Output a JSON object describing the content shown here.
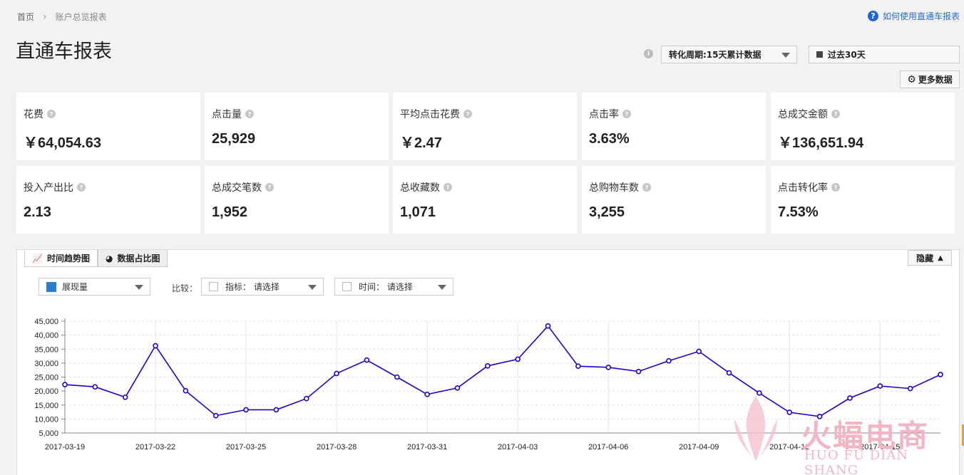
{
  "breadcrumb": {
    "home": "首页",
    "current": "账户总览报表"
  },
  "help_link": "如何使用直通车报表",
  "page_title": "直通车报表",
  "period_select": "转化周期:15天累计数据",
  "range_select": "过去30天",
  "more_data_button": "更多数据",
  "metrics": [
    {
      "label": "花费",
      "value": "￥64,054.63"
    },
    {
      "label": "点击量",
      "value": "25,929"
    },
    {
      "label": "平均点击花费",
      "value": "￥2.47"
    },
    {
      "label": "点击率",
      "value": "3.63%"
    },
    {
      "label": "总成交金额",
      "value": "￥136,651.94"
    },
    {
      "label": "投入产出比",
      "value": "2.13"
    },
    {
      "label": "总成交笔数",
      "value": "1,952"
    },
    {
      "label": "总收藏数",
      "value": "1,071"
    },
    {
      "label": "总购物车数",
      "value": "3,255"
    },
    {
      "label": "点击转化率",
      "value": "7.53%"
    }
  ],
  "tabs": {
    "trend": "时间趋势图",
    "share": "数据占比图"
  },
  "hide_button": "隐藏",
  "filters": {
    "metric_select": "展现量",
    "compare_label": "比较：",
    "indicator": "指标：  请选择",
    "time": "时间：  请选择"
  },
  "watermark": {
    "text": "火蝠电商",
    "sub": "HUO FU DIAN SHANG"
  },
  "colors": {
    "line": "#2200cc",
    "accent": "#2a7fd0"
  },
  "chart_data": {
    "type": "line",
    "x": [
      "2017-03-19",
      "2017-03-20",
      "2017-03-21",
      "2017-03-22",
      "2017-03-23",
      "2017-03-24",
      "2017-03-25",
      "2017-03-26",
      "2017-03-27",
      "2017-03-28",
      "2017-03-29",
      "2017-03-30",
      "2017-03-31",
      "2017-04-01",
      "2017-04-02",
      "2017-04-03",
      "2017-04-04",
      "2017-04-05",
      "2017-04-06",
      "2017-04-07",
      "2017-04-08",
      "2017-04-09",
      "2017-04-10",
      "2017-04-11",
      "2017-04-12",
      "2017-04-13",
      "2017-04-14",
      "2017-04-15",
      "2017-04-16",
      "2017-04-17"
    ],
    "x_tick_labels": [
      "2017-03-19",
      "2017-03-22",
      "2017-03-25",
      "2017-03-28",
      "2017-03-31",
      "2017-04-03",
      "2017-04-06",
      "2017-04-09",
      "2017-04-12",
      "2017-04-15"
    ],
    "series": [
      {
        "values": [
          22300,
          21500,
          17800,
          36200,
          20100,
          11200,
          13300,
          13300,
          17300,
          26300,
          31100,
          25000,
          18800,
          21100,
          29000,
          31400,
          43300,
          28900,
          28500,
          27000,
          30800,
          34200,
          26500,
          19300,
          12400,
          10900,
          17500,
          21800,
          20900,
          25900
        ]
      }
    ],
    "y_ticks": [
      "5,000",
      "10,000",
      "15,000",
      "20,000",
      "25,000",
      "30,000",
      "35,000",
      "40,000",
      "45,000"
    ],
    "ylim": [
      5000,
      45000
    ],
    "grid": true
  }
}
